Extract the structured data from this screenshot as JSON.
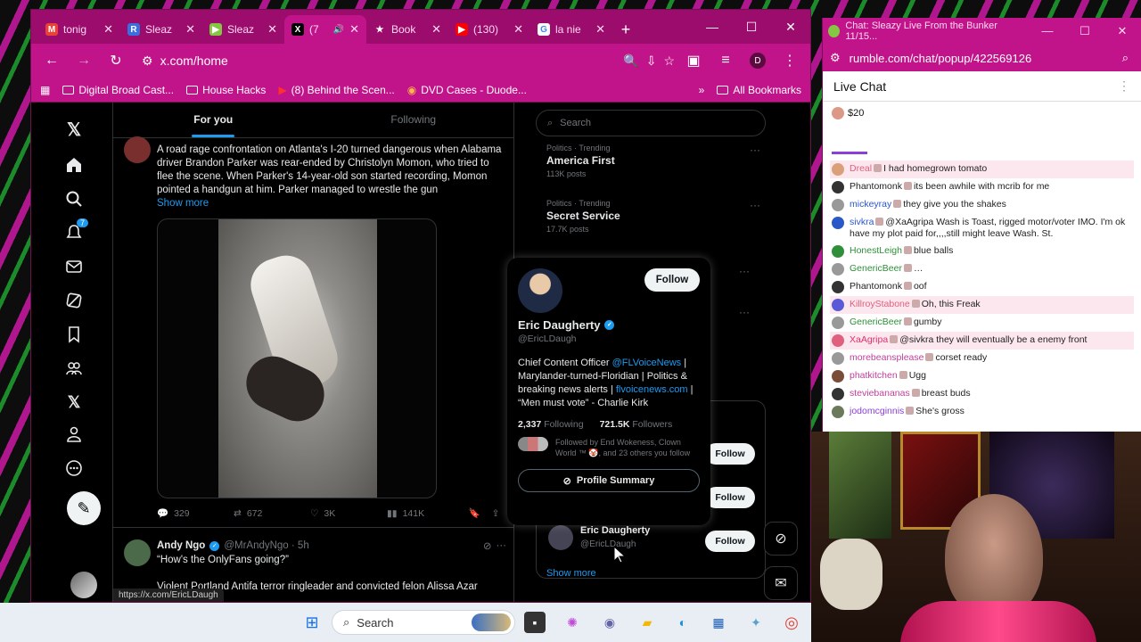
{
  "browser": {
    "tabs": [
      {
        "label": "tonig",
        "icon": "gmail-icon",
        "color": "#ea4335"
      },
      {
        "label": "Sleaz",
        "icon": "r-icon",
        "color": "#3b6fe0"
      },
      {
        "label": "Sleaz",
        "icon": "play-icon",
        "color": "#85c742"
      },
      {
        "label": "(7",
        "icon": "x-icon",
        "color": "#000000"
      },
      {
        "label": "Book",
        "icon": "star-icon",
        "color": "#ffffff"
      },
      {
        "label": "(130)",
        "icon": "youtube-icon",
        "color": "#ff0000"
      },
      {
        "label": "la nie",
        "icon": "google-icon",
        "color": "#4285f4"
      }
    ],
    "url": "x.com/home",
    "profile_initial": "D",
    "bookmarks": [
      "Digital Broad Cast...",
      "House Hacks",
      "(8) Behind the Scen...",
      "DVD Cases - Duode..."
    ],
    "all_bookmarks": "All Bookmarks",
    "status_url": "https://x.com/EricLDaugh"
  },
  "x": {
    "tabs": {
      "for_you": "For you",
      "following": "Following"
    },
    "notification_count": "7",
    "post1": {
      "text": "A road rage confrontation on Atlanta's I-20 turned dangerous when Alabama driver Brandon Parker was rear-ended by Christolyn Momon, who tried to flee the scene. When Parker's 14-year-old son started recording, Momon pointed a handgun at him. Parker managed to wrestle the gun",
      "show_more": "Show more",
      "replies": "329",
      "reposts": "672",
      "likes": "3K",
      "views": "141K"
    },
    "post2": {
      "name": "Andy Ngo",
      "meta": "@MrAndyNgo · 5h",
      "line1": "“How's the OnlyFans going?”",
      "line2": "Violent Portland Antifa terror ringleader and convicted felon Alissa Azar"
    },
    "search_placeholder": "Search",
    "trends": [
      {
        "category": "Politics · Trending",
        "title": "America First",
        "count": "113K posts"
      },
      {
        "category": "Politics · Trending",
        "title": "Secret Service",
        "count": "17.7K posts"
      }
    ],
    "follow_label": "Follow",
    "who_to_follow": {
      "name": "Eric Daugherty",
      "handle": "@EricLDaugh"
    },
    "show_more": "Show more",
    "hovercard": {
      "follow": "Follow",
      "name": "Eric Daugherty",
      "handle": "@EricLDaugh",
      "bio_a": "Chief Content Officer ",
      "bio_link1": "@FLVoiceNews",
      "bio_b": " | Marylander-turned-Floridian | Politics & breaking news alerts | ",
      "bio_link2": "flvoicenews.com",
      "bio_c": " | “Men must vote” - Charlie Kirk",
      "following_count": "2,337",
      "following_label": "Following",
      "followers_count": "721.5K",
      "followers_label": "Followers",
      "followed_by": "Followed by End Wokeness, Clown World ™ 🤡, and 23 others you follow",
      "summary": "Profile Summary"
    }
  },
  "rumble": {
    "title": "Chat: Sleazy Live From the Bunker 11/15...",
    "url": "rumble.com/chat/popup/422569126",
    "heading": "Live Chat",
    "rant": "$20",
    "messages": [
      {
        "user": "Dreal",
        "text": "I had homegrown tomato",
        "color": "#e0607e",
        "highlight": true
      },
      {
        "user": "Phantomonk",
        "text": "its been awhile with mcrib for me",
        "color": "#222222",
        "highlight": false
      },
      {
        "user": "mickeyray",
        "text": "they give you the shakes",
        "color": "#2a58c9",
        "highlight": false
      },
      {
        "user": "sivkra",
        "text": "@XaAgripa Wash is Toast, rigged motor/voter IMO. I'm ok have my plot paid for,,,,still might leave Wash. St.",
        "color": "#2a58c9",
        "highlight": false
      },
      {
        "user": "HonestLeigh",
        "text": "blue balls",
        "color": "#2f8f3a",
        "highlight": false
      },
      {
        "user": "GenericBeer",
        "text": "…",
        "color": "#2f8f3a",
        "highlight": false
      },
      {
        "user": "Phantomonk",
        "text": "oof",
        "color": "#222222",
        "highlight": false
      },
      {
        "user": "KillroyStabone",
        "text": "Oh, this Freak",
        "color": "#e0607e",
        "highlight": true
      },
      {
        "user": "GenericBeer",
        "text": "gumby",
        "color": "#2f8f3a",
        "highlight": false
      },
      {
        "user": "XaAgripa",
        "text": "@sivkra they will eventually be a enemy front",
        "color": "#e0306e",
        "highlight": true
      },
      {
        "user": "morebeansplease",
        "text": "corset ready",
        "color": "#c0409a",
        "highlight": false
      },
      {
        "user": "phatkitchen",
        "text": "Ugg",
        "color": "#c0409a",
        "highlight": false
      },
      {
        "user": "steviebananas",
        "text": "breast buds",
        "color": "#c0409a",
        "highlight": false
      },
      {
        "user": "jodomcginnis",
        "text": "She's gross",
        "color": "#8a3fd8",
        "highlight": false
      }
    ]
  },
  "taskbar": {
    "search_placeholder": "Search"
  }
}
